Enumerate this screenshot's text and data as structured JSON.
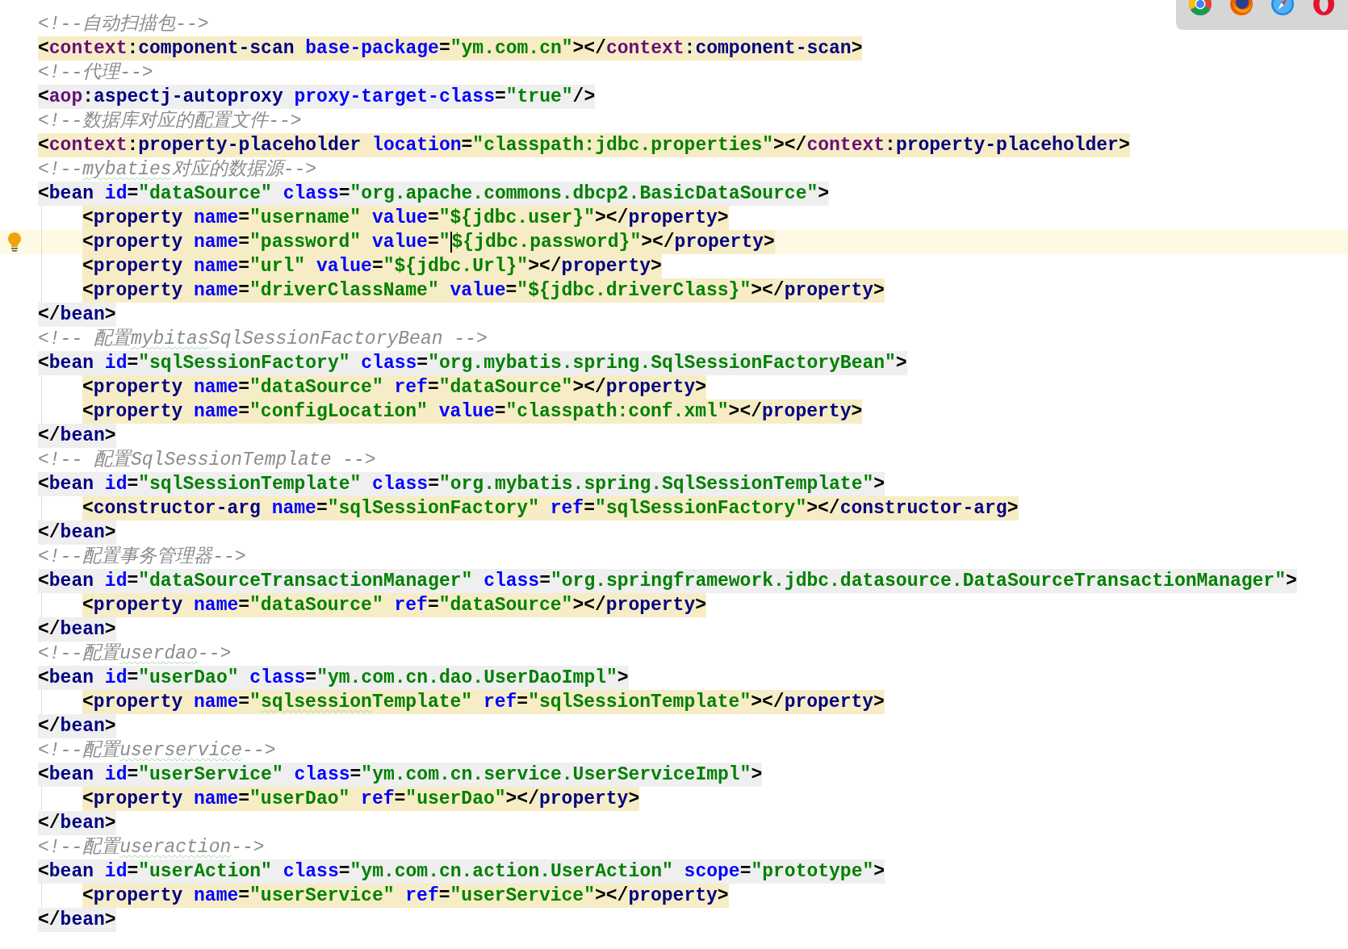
{
  "editor": {
    "lines": [
      {
        "tokens": [
          {
            "kind": "comment",
            "text": "<!--自动扫描包-->"
          }
        ]
      },
      {
        "color": "#f6edc6",
        "tokens": [
          {
            "kind": "punct",
            "text": "<"
          },
          {
            "kind": "ns",
            "text": "context"
          },
          {
            "kind": "punct",
            "text": ":"
          },
          {
            "kind": "tag",
            "text": "component-scan"
          },
          {
            "kind": "attr",
            "text": " base-package"
          },
          {
            "kind": "punct",
            "text": "="
          },
          {
            "kind": "value",
            "text": "\"ym.com.cn\""
          },
          {
            "kind": "punct",
            "text": "></"
          },
          {
            "kind": "ns",
            "text": "context"
          },
          {
            "kind": "punct",
            "text": ":"
          },
          {
            "kind": "tag",
            "text": "component-scan"
          },
          {
            "kind": "punct",
            "text": ">"
          }
        ]
      },
      {
        "tokens": [
          {
            "kind": "comment",
            "text": "<!--代理-->"
          }
        ]
      },
      {
        "color": "#efefef",
        "tokens": [
          {
            "kind": "punct",
            "text": "<"
          },
          {
            "kind": "ns",
            "text": "aop"
          },
          {
            "kind": "punct",
            "text": ":"
          },
          {
            "kind": "tag",
            "text": "aspectj-autoproxy"
          },
          {
            "kind": "attr",
            "text": " proxy-target-class"
          },
          {
            "kind": "punct",
            "text": "="
          },
          {
            "kind": "value",
            "text": "\"true\""
          },
          {
            "kind": "punct",
            "text": "/>"
          }
        ]
      },
      {
        "tokens": [
          {
            "kind": "comment",
            "text": "<!--数据库对应的配置文件-->"
          }
        ]
      },
      {
        "color": "#f6edc6",
        "tokens": [
          {
            "kind": "punct",
            "text": "<"
          },
          {
            "kind": "ns",
            "text": "context"
          },
          {
            "kind": "punct",
            "text": ":"
          },
          {
            "kind": "tag",
            "text": "property-placeholder"
          },
          {
            "kind": "attr",
            "text": " location"
          },
          {
            "kind": "punct",
            "text": "="
          },
          {
            "kind": "value",
            "text": "\"classpath:jdbc.properties\""
          },
          {
            "kind": "punct",
            "text": "></"
          },
          {
            "kind": "ns",
            "text": "context"
          },
          {
            "kind": "punct",
            "text": ":"
          },
          {
            "kind": "tag",
            "text": "property-placeholder"
          },
          {
            "kind": "punct",
            "text": ">"
          }
        ]
      },
      {
        "tokens": [
          {
            "kind": "comment",
            "text": "<!--"
          },
          {
            "kind": "comment",
            "text": "mybaties",
            "wavy": true
          },
          {
            "kind": "comment",
            "text": "对应的数据源-->"
          }
        ]
      },
      {
        "color": "#efefef",
        "tokens": [
          {
            "kind": "punct",
            "text": "<"
          },
          {
            "kind": "tag",
            "text": "bean"
          },
          {
            "kind": "attr",
            "text": " id"
          },
          {
            "kind": "punct",
            "text": "="
          },
          {
            "kind": "value",
            "text": "\"dataSource\""
          },
          {
            "kind": "attr",
            "text": " class"
          },
          {
            "kind": "punct",
            "text": "="
          },
          {
            "kind": "value",
            "text": "\"org.apache.commons.dbcp2.BasicDataSource\""
          },
          {
            "kind": "punct",
            "text": ">"
          }
        ],
        "children": [
          {
            "color": "#f6edc6",
            "tokens": [
              {
                "kind": "punct",
                "text": "<"
              },
              {
                "kind": "tag",
                "text": "property"
              },
              {
                "kind": "attr",
                "text": " name"
              },
              {
                "kind": "punct",
                "text": "="
              },
              {
                "kind": "value",
                "text": "\"username\""
              },
              {
                "kind": "attr",
                "text": " value"
              },
              {
                "kind": "punct",
                "text": "="
              },
              {
                "kind": "value",
                "text": "\"${jdbc.user}\""
              },
              {
                "kind": "punct",
                "text": "></"
              },
              {
                "kind": "tag",
                "text": "property"
              },
              {
                "kind": "punct",
                "text": ">"
              }
            ]
          },
          {
            "color": "#f6edc6",
            "current": true,
            "bulb": true,
            "tokens": [
              {
                "kind": "punct",
                "text": "<"
              },
              {
                "kind": "tag",
                "text": "property"
              },
              {
                "kind": "attr",
                "text": " name"
              },
              {
                "kind": "punct",
                "text": "="
              },
              {
                "kind": "value",
                "text": "\"password\""
              },
              {
                "kind": "attr",
                "text": " value"
              },
              {
                "kind": "punct",
                "text": "="
              },
              {
                "kind": "value",
                "text": "\""
              },
              {
                "kind": "value",
                "text": "${jdbc.password}\"",
                "caret": true
              },
              {
                "kind": "punct",
                "text": "></"
              },
              {
                "kind": "tag",
                "text": "property"
              },
              {
                "kind": "punct",
                "text": ">"
              }
            ]
          },
          {
            "color": "#f6edc6",
            "tokens": [
              {
                "kind": "punct",
                "text": "<"
              },
              {
                "kind": "tag",
                "text": "property"
              },
              {
                "kind": "attr",
                "text": " name"
              },
              {
                "kind": "punct",
                "text": "="
              },
              {
                "kind": "value",
                "text": "\"url\""
              },
              {
                "kind": "attr",
                "text": " value"
              },
              {
                "kind": "punct",
                "text": "="
              },
              {
                "kind": "value",
                "text": "\"${jdbc.Url}\""
              },
              {
                "kind": "punct",
                "text": "></"
              },
              {
                "kind": "tag",
                "text": "property"
              },
              {
                "kind": "punct",
                "text": ">"
              }
            ]
          },
          {
            "color": "#f6edc6",
            "tokens": [
              {
                "kind": "punct",
                "text": "<"
              },
              {
                "kind": "tag",
                "text": "property"
              },
              {
                "kind": "attr",
                "text": " name"
              },
              {
                "kind": "punct",
                "text": "="
              },
              {
                "kind": "value",
                "text": "\"driverClassName\""
              },
              {
                "kind": "attr",
                "text": " value"
              },
              {
                "kind": "punct",
                "text": "="
              },
              {
                "kind": "value",
                "text": "\"${jdbc.driverClass}\""
              },
              {
                "kind": "punct",
                "text": "></"
              },
              {
                "kind": "tag",
                "text": "property"
              },
              {
                "kind": "punct",
                "text": ">"
              }
            ]
          }
        ]
      },
      {
        "color": "#efefef",
        "tokens": [
          {
            "kind": "punct",
            "text": "</"
          },
          {
            "kind": "tag",
            "text": "bean"
          },
          {
            "kind": "punct",
            "text": ">"
          }
        ]
      },
      {
        "tokens": [
          {
            "kind": "comment",
            "text": "<!-- 配置"
          },
          {
            "kind": "comment",
            "text": "mybitas",
            "wavy": true
          },
          {
            "kind": "comment",
            "text": "SqlSessionFactoryBean -->"
          }
        ]
      },
      {
        "color": "#efefef",
        "tokens": [
          {
            "kind": "punct",
            "text": "<"
          },
          {
            "kind": "tag",
            "text": "bean"
          },
          {
            "kind": "attr",
            "text": " id"
          },
          {
            "kind": "punct",
            "text": "="
          },
          {
            "kind": "value",
            "text": "\"sqlSessionFactory\""
          },
          {
            "kind": "attr",
            "text": " class"
          },
          {
            "kind": "punct",
            "text": "="
          },
          {
            "kind": "value",
            "text": "\"org.mybatis.spring.SqlSessionFactoryBean\""
          },
          {
            "kind": "punct",
            "text": ">"
          }
        ],
        "children": [
          {
            "color": "#f6edc6",
            "tokens": [
              {
                "kind": "punct",
                "text": "<"
              },
              {
                "kind": "tag",
                "text": "property"
              },
              {
                "kind": "attr",
                "text": " name"
              },
              {
                "kind": "punct",
                "text": "="
              },
              {
                "kind": "value",
                "text": "\"dataSource\""
              },
              {
                "kind": "attr",
                "text": " ref"
              },
              {
                "kind": "punct",
                "text": "="
              },
              {
                "kind": "value",
                "text": "\"dataSource\""
              },
              {
                "kind": "punct",
                "text": "></"
              },
              {
                "kind": "tag",
                "text": "property"
              },
              {
                "kind": "punct",
                "text": ">"
              }
            ]
          },
          {
            "color": "#f6edc6",
            "tokens": [
              {
                "kind": "punct",
                "text": "<"
              },
              {
                "kind": "tag",
                "text": "property"
              },
              {
                "kind": "attr",
                "text": " name"
              },
              {
                "kind": "punct",
                "text": "="
              },
              {
                "kind": "value",
                "text": "\"configLocation\""
              },
              {
                "kind": "attr",
                "text": " value"
              },
              {
                "kind": "punct",
                "text": "="
              },
              {
                "kind": "value",
                "text": "\"classpath:conf.xml\""
              },
              {
                "kind": "punct",
                "text": "></"
              },
              {
                "kind": "tag",
                "text": "property"
              },
              {
                "kind": "punct",
                "text": ">"
              }
            ]
          }
        ]
      },
      {
        "color": "#efefef",
        "tokens": [
          {
            "kind": "punct",
            "text": "</"
          },
          {
            "kind": "tag",
            "text": "bean"
          },
          {
            "kind": "punct",
            "text": ">"
          }
        ]
      },
      {
        "tokens": [
          {
            "kind": "comment",
            "text": "<!-- 配置SqlSessionTemplate -->"
          }
        ]
      },
      {
        "color": "#efefef",
        "tokens": [
          {
            "kind": "punct",
            "text": "<"
          },
          {
            "kind": "tag",
            "text": "bean"
          },
          {
            "kind": "attr",
            "text": " id"
          },
          {
            "kind": "punct",
            "text": "="
          },
          {
            "kind": "value",
            "text": "\"sqlSessionTemplate\""
          },
          {
            "kind": "attr",
            "text": " class"
          },
          {
            "kind": "punct",
            "text": "="
          },
          {
            "kind": "value",
            "text": "\"org.mybatis.spring.SqlSessionTemplate\""
          },
          {
            "kind": "punct",
            "text": ">"
          }
        ],
        "children": [
          {
            "color": "#f6edc6",
            "tokens": [
              {
                "kind": "punct",
                "text": "<"
              },
              {
                "kind": "tag",
                "text": "constructor-arg"
              },
              {
                "kind": "attr",
                "text": " name"
              },
              {
                "kind": "punct",
                "text": "="
              },
              {
                "kind": "value",
                "text": "\"sqlSessionFactory\""
              },
              {
                "kind": "attr",
                "text": " ref"
              },
              {
                "kind": "punct",
                "text": "="
              },
              {
                "kind": "value",
                "text": "\"sqlSessionFactory\""
              },
              {
                "kind": "punct",
                "text": "></"
              },
              {
                "kind": "tag",
                "text": "constructor-arg"
              },
              {
                "kind": "punct",
                "text": ">"
              }
            ]
          }
        ]
      },
      {
        "color": "#efefef",
        "tokens": [
          {
            "kind": "punct",
            "text": "</"
          },
          {
            "kind": "tag",
            "text": "bean"
          },
          {
            "kind": "punct",
            "text": ">"
          }
        ]
      },
      {
        "tokens": [
          {
            "kind": "comment",
            "text": "<!--配置事务管理器-->"
          }
        ]
      },
      {
        "color": "#efefef",
        "tokens": [
          {
            "kind": "punct",
            "text": "<"
          },
          {
            "kind": "tag",
            "text": "bean"
          },
          {
            "kind": "attr",
            "text": " id"
          },
          {
            "kind": "punct",
            "text": "="
          },
          {
            "kind": "value",
            "text": "\"dataSourceTransactionManager\""
          },
          {
            "kind": "attr",
            "text": " class"
          },
          {
            "kind": "punct",
            "text": "="
          },
          {
            "kind": "value",
            "text": "\"org.springframework.jdbc.datasource.DataSourceTransactionManager\""
          },
          {
            "kind": "punct",
            "text": ">"
          }
        ],
        "children": [
          {
            "color": "#f6edc6",
            "tokens": [
              {
                "kind": "punct",
                "text": "<"
              },
              {
                "kind": "tag",
                "text": "property"
              },
              {
                "kind": "attr",
                "text": " name"
              },
              {
                "kind": "punct",
                "text": "="
              },
              {
                "kind": "value",
                "text": "\"dataSource\""
              },
              {
                "kind": "attr",
                "text": " ref"
              },
              {
                "kind": "punct",
                "text": "="
              },
              {
                "kind": "value",
                "text": "\"dataSource\""
              },
              {
                "kind": "punct",
                "text": "></"
              },
              {
                "kind": "tag",
                "text": "property"
              },
              {
                "kind": "punct",
                "text": ">"
              }
            ]
          }
        ]
      },
      {
        "color": "#efefef",
        "tokens": [
          {
            "kind": "punct",
            "text": "</"
          },
          {
            "kind": "tag",
            "text": "bean"
          },
          {
            "kind": "punct",
            "text": ">"
          }
        ]
      },
      {
        "tokens": [
          {
            "kind": "comment",
            "text": "<!--配置"
          },
          {
            "kind": "comment",
            "text": "userdao",
            "wavy": true
          },
          {
            "kind": "comment",
            "text": "-->"
          }
        ]
      },
      {
        "color": "#efefef",
        "tokens": [
          {
            "kind": "punct",
            "text": "<"
          },
          {
            "kind": "tag",
            "text": "bean"
          },
          {
            "kind": "attr",
            "text": " id"
          },
          {
            "kind": "punct",
            "text": "="
          },
          {
            "kind": "value",
            "text": "\"userDao\""
          },
          {
            "kind": "attr",
            "text": " class"
          },
          {
            "kind": "punct",
            "text": "="
          },
          {
            "kind": "value",
            "text": "\"ym.com.cn.dao.UserDaoImpl\""
          },
          {
            "kind": "punct",
            "text": ">"
          }
        ],
        "children": [
          {
            "color": "#f6edc6",
            "tokens": [
              {
                "kind": "punct",
                "text": "<"
              },
              {
                "kind": "tag",
                "text": "property"
              },
              {
                "kind": "attr",
                "text": " name"
              },
              {
                "kind": "punct",
                "text": "="
              },
              {
                "kind": "value",
                "text": "\""
              },
              {
                "kind": "value",
                "text": "sqlsession",
                "wavy": true
              },
              {
                "kind": "value",
                "text": "Template\""
              },
              {
                "kind": "attr",
                "text": " ref"
              },
              {
                "kind": "punct",
                "text": "="
              },
              {
                "kind": "value",
                "text": "\"sqlSessionTemplate\""
              },
              {
                "kind": "punct",
                "text": "></"
              },
              {
                "kind": "tag",
                "text": "property"
              },
              {
                "kind": "punct",
                "text": ">"
              }
            ]
          }
        ]
      },
      {
        "color": "#efefef",
        "tokens": [
          {
            "kind": "punct",
            "text": "</"
          },
          {
            "kind": "tag",
            "text": "bean"
          },
          {
            "kind": "punct",
            "text": ">"
          }
        ]
      },
      {
        "tokens": [
          {
            "kind": "comment",
            "text": "<!--配置"
          },
          {
            "kind": "comment",
            "text": "userservice",
            "wavy": true
          },
          {
            "kind": "comment",
            "text": "-->"
          }
        ]
      },
      {
        "color": "#efefef",
        "tokens": [
          {
            "kind": "punct",
            "text": "<"
          },
          {
            "kind": "tag",
            "text": "bean"
          },
          {
            "kind": "attr",
            "text": " id"
          },
          {
            "kind": "punct",
            "text": "="
          },
          {
            "kind": "value",
            "text": "\"userService\""
          },
          {
            "kind": "attr",
            "text": " class"
          },
          {
            "kind": "punct",
            "text": "="
          },
          {
            "kind": "value",
            "text": "\"ym.com.cn.service.UserServiceImpl\""
          },
          {
            "kind": "punct",
            "text": ">"
          }
        ],
        "children": [
          {
            "color": "#f6edc6",
            "tokens": [
              {
                "kind": "punct",
                "text": "<"
              },
              {
                "kind": "tag",
                "text": "property"
              },
              {
                "kind": "attr",
                "text": " name"
              },
              {
                "kind": "punct",
                "text": "="
              },
              {
                "kind": "value",
                "text": "\"userDao\""
              },
              {
                "kind": "attr",
                "text": " ref"
              },
              {
                "kind": "punct",
                "text": "="
              },
              {
                "kind": "value",
                "text": "\"userDao\""
              },
              {
                "kind": "punct",
                "text": "></"
              },
              {
                "kind": "tag",
                "text": "property"
              },
              {
                "kind": "punct",
                "text": ">"
              }
            ]
          }
        ]
      },
      {
        "color": "#efefef",
        "tokens": [
          {
            "kind": "punct",
            "text": "</"
          },
          {
            "kind": "tag",
            "text": "bean"
          },
          {
            "kind": "punct",
            "text": ">"
          }
        ]
      },
      {
        "tokens": [
          {
            "kind": "comment",
            "text": "<!--配置"
          },
          {
            "kind": "comment",
            "text": "useraction",
            "wavy": true
          },
          {
            "kind": "comment",
            "text": "-->"
          }
        ]
      },
      {
        "color": "#efefef",
        "tokens": [
          {
            "kind": "punct",
            "text": "<"
          },
          {
            "kind": "tag",
            "text": "bean"
          },
          {
            "kind": "attr",
            "text": " id"
          },
          {
            "kind": "punct",
            "text": "="
          },
          {
            "kind": "value",
            "text": "\"userAction\""
          },
          {
            "kind": "attr",
            "text": " class"
          },
          {
            "kind": "punct",
            "text": "="
          },
          {
            "kind": "value",
            "text": "\"ym.com.cn.action.UserAction\""
          },
          {
            "kind": "attr",
            "text": " scope"
          },
          {
            "kind": "punct",
            "text": "="
          },
          {
            "kind": "value",
            "text": "\"prototype\""
          },
          {
            "kind": "punct",
            "text": ">"
          }
        ],
        "children": [
          {
            "color": "#f6edc6",
            "tokens": [
              {
                "kind": "punct",
                "text": "<"
              },
              {
                "kind": "tag",
                "text": "property"
              },
              {
                "kind": "attr",
                "text": " name"
              },
              {
                "kind": "punct",
                "text": "="
              },
              {
                "kind": "value",
                "text": "\"userService\""
              },
              {
                "kind": "attr",
                "text": " ref"
              },
              {
                "kind": "punct",
                "text": "="
              },
              {
                "kind": "value",
                "text": "\"userService\""
              },
              {
                "kind": "punct",
                "text": "></"
              },
              {
                "kind": "tag",
                "text": "property"
              },
              {
                "kind": "punct",
                "text": ">"
              }
            ]
          }
        ]
      },
      {
        "color": "#efefef",
        "tokens": [
          {
            "kind": "punct",
            "text": "</"
          },
          {
            "kind": "tag",
            "text": "bean"
          },
          {
            "kind": "punct",
            "text": ">"
          }
        ]
      }
    ]
  }
}
